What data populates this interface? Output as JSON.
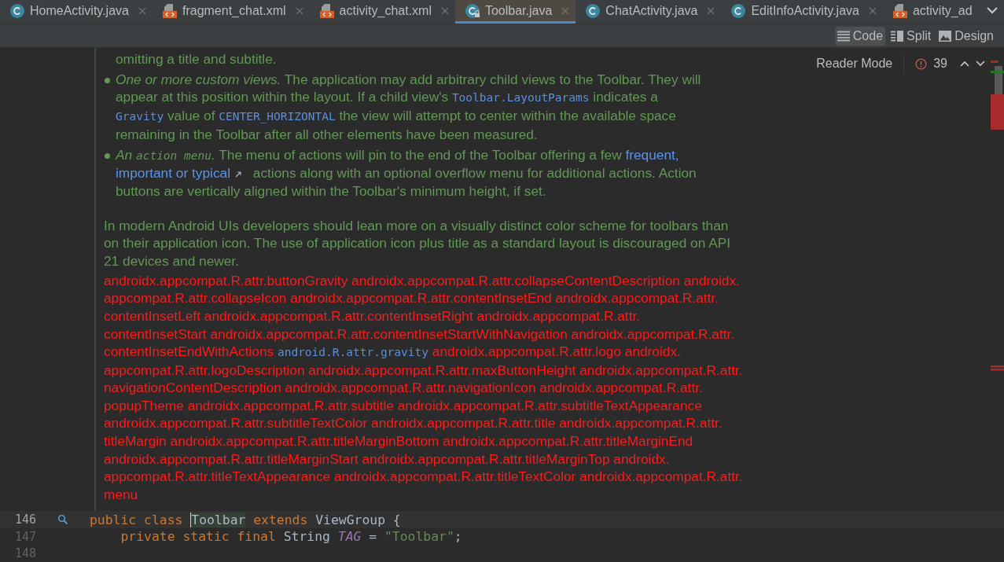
{
  "tabs": [
    {
      "label": "HomeActivity.java",
      "kind": "java",
      "selected": false,
      "locked": false,
      "closable": true
    },
    {
      "label": "fragment_chat.xml",
      "kind": "xml",
      "selected": false,
      "closable": true
    },
    {
      "label": "activity_chat.xml",
      "kind": "xml",
      "selected": false,
      "closable": true
    },
    {
      "label": "Toolbar.java",
      "kind": "java",
      "selected": true,
      "locked": true,
      "closable": true
    },
    {
      "label": "ChatActivity.java",
      "kind": "java",
      "selected": false,
      "locked": false,
      "closable": true
    },
    {
      "label": "EditInfoActivity.java",
      "kind": "java",
      "selected": false,
      "locked": false,
      "closable": true
    },
    {
      "label": "activity_ad",
      "kind": "xml",
      "selected": false,
      "closable": false
    }
  ],
  "view_modes": [
    {
      "label": "Code",
      "kind": "code",
      "selected": true
    },
    {
      "label": "Split",
      "kind": "split",
      "selected": false
    },
    {
      "label": "Design",
      "kind": "design",
      "selected": false
    }
  ],
  "reader_mode": "Reader Mode",
  "problems": {
    "count": "39"
  },
  "doc": [
    {
      "kind": "continuation",
      "lines": [
        [
          {
            "kind": "plain",
            "text": "omitting a title and subtitle."
          }
        ]
      ]
    },
    {
      "kind": "bullet",
      "lines": [
        [
          {
            "kind": "em",
            "text": "One or more custom views."
          },
          {
            "kind": "plain",
            "text": " The application may add arbitrary child views to the Toolbar. They will"
          }
        ],
        [
          {
            "kind": "plain",
            "text": "appear at this position within the layout. If a child view's "
          },
          {
            "kind": "code",
            "text": "Toolbar.LayoutParams"
          },
          {
            "kind": "plain",
            "text": " indicates a"
          }
        ],
        [
          {
            "kind": "code",
            "text": "Gravity"
          },
          {
            "kind": "plain",
            "text": " value of "
          },
          {
            "kind": "code",
            "text": "CENTER_HORIZONTAL"
          },
          {
            "kind": "plain",
            "text": " the view will attempt to center within the available space"
          }
        ],
        [
          {
            "kind": "plain",
            "text": "remaining in the Toolbar after all other elements have been measured."
          }
        ]
      ]
    },
    {
      "kind": "bullet",
      "lines": [
        [
          {
            "kind": "em",
            "text": "An "
          },
          {
            "kind": "emcode",
            "text": "action menu"
          },
          {
            "kind": "em",
            "text": "."
          },
          {
            "kind": "plain",
            "text": " The menu of actions will pin to the end of the Toolbar offering a few "
          },
          {
            "kind": "link",
            "text": "frequent,"
          }
        ],
        [
          {
            "kind": "link_ext",
            "text": "important or typical"
          },
          {
            "kind": "plain",
            "text": " actions along with an optional overflow menu for additional actions. Action"
          }
        ],
        [
          {
            "kind": "plain",
            "text": "buttons are vertically aligned within the Toolbar's minimum height, if set."
          }
        ]
      ]
    },
    {
      "kind": "paragraph",
      "lines": [
        [
          {
            "kind": "plain",
            "text": "In modern Android UIs developers should lean more on a visually distinct color scheme for toolbars than"
          }
        ],
        [
          {
            "kind": "plain",
            "text": "on their application icon. The use of application icon plus title as a standard layout is discouraged on API"
          }
        ],
        [
          {
            "kind": "plain",
            "text": "21 devices and newer."
          }
        ]
      ]
    },
    {
      "kind": "unresolved",
      "lines": [
        [
          {
            "kind": "plain",
            "text": "androidx.appcompat.R.attr.buttonGravity androidx.appcompat.R.attr.collapseContentDescription androidx."
          }
        ],
        [
          {
            "kind": "plain",
            "text": "appcompat.R.attr.collapseIcon androidx.appcompat.R.attr.contentInsetEnd androidx.appcompat.R.attr."
          }
        ],
        [
          {
            "kind": "plain",
            "text": "contentInsetLeft androidx.appcompat.R.attr.contentInsetRight androidx.appcompat.R.attr."
          }
        ],
        [
          {
            "kind": "plain",
            "text": "contentInsetStart androidx.appcompat.R.attr.contentInsetStartWithNavigation androidx.appcompat.R.attr."
          }
        ],
        [
          {
            "kind": "plain",
            "text": "contentInsetEndWithActions "
          },
          {
            "kind": "code",
            "text": "android.R.attr.gravity"
          },
          {
            "kind": "plain",
            "text": " androidx.appcompat.R.attr.logo androidx."
          }
        ],
        [
          {
            "kind": "plain",
            "text": "appcompat.R.attr.logoDescription androidx.appcompat.R.attr.maxButtonHeight androidx.appcompat.R.attr."
          }
        ],
        [
          {
            "kind": "plain",
            "text": "navigationContentDescription androidx.appcompat.R.attr.navigationIcon androidx.appcompat.R.attr."
          }
        ],
        [
          {
            "kind": "plain",
            "text": "popupTheme androidx.appcompat.R.attr.subtitle androidx.appcompat.R.attr.subtitleTextAppearance"
          }
        ],
        [
          {
            "kind": "plain",
            "text": "androidx.appcompat.R.attr.subtitleTextColor androidx.appcompat.R.attr.title androidx.appcompat.R.attr."
          }
        ],
        [
          {
            "kind": "plain",
            "text": "titleMargin androidx.appcompat.R.attr.titleMarginBottom androidx.appcompat.R.attr.titleMarginEnd"
          }
        ],
        [
          {
            "kind": "plain",
            "text": "androidx.appcompat.R.attr.titleMarginStart androidx.appcompat.R.attr.titleMarginTop androidx."
          }
        ],
        [
          {
            "kind": "plain",
            "text": "appcompat.R.attr.titleTextAppearance androidx.appcompat.R.attr.titleTextColor androidx.appcompat.R.attr."
          }
        ],
        [
          {
            "kind": "plain",
            "text": "menu"
          }
        ]
      ]
    }
  ],
  "code_lines": [
    {
      "number": "146",
      "current": true,
      "marker": true,
      "tokens": [
        {
          "kind": "keyword",
          "text": "public class "
        },
        {
          "kind": "caret_word",
          "text": "Toolbar"
        },
        {
          "kind": "keyword",
          "text": " extends "
        },
        {
          "kind": "plain",
          "text": "ViewGroup {"
        }
      ]
    },
    {
      "number": "147",
      "current": false,
      "marker": false,
      "tokens": [
        {
          "kind": "keyword",
          "text": "    private static final "
        },
        {
          "kind": "plain",
          "text": "String "
        },
        {
          "kind": "constant",
          "text": "TAG"
        },
        {
          "kind": "plain",
          "text": " = "
        },
        {
          "kind": "string",
          "text": "\"Toolbar\""
        },
        {
          "kind": "plain",
          "text": ";"
        }
      ]
    },
    {
      "number": "148",
      "current": false,
      "marker": false
    }
  ]
}
